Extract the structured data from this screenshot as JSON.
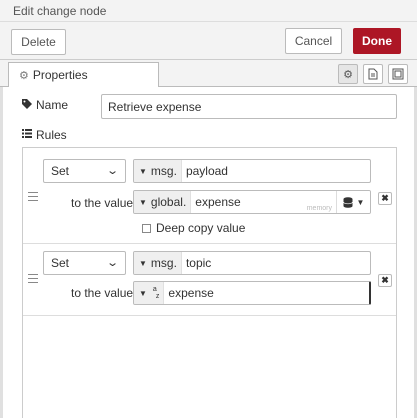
{
  "header": {
    "title": "Edit change node"
  },
  "toolbar": {
    "delete_label": "Delete",
    "cancel_label": "Cancel",
    "done_label": "Done"
  },
  "tabs": {
    "properties_label": "Properties",
    "icons": [
      "gear-icon",
      "description-icon",
      "appearance-icon"
    ]
  },
  "form": {
    "name_label": "Name",
    "name_value": "Retrieve expense",
    "rules_label": "Rules"
  },
  "rules": [
    {
      "action": "Set",
      "target_type": "msg.",
      "target_value": "payload",
      "to_label": "to the value",
      "value_type": "global.",
      "value": "expense",
      "store_hint": "memory",
      "deep_copy_label": "Deep copy value"
    },
    {
      "action": "Set",
      "target_type": "msg.",
      "target_value": "topic",
      "to_label": "to the value",
      "value_type": "a z",
      "value": "expense"
    }
  ],
  "colors": {
    "done_button": "#ad1625",
    "panel_bg": "#f3f3f3"
  }
}
